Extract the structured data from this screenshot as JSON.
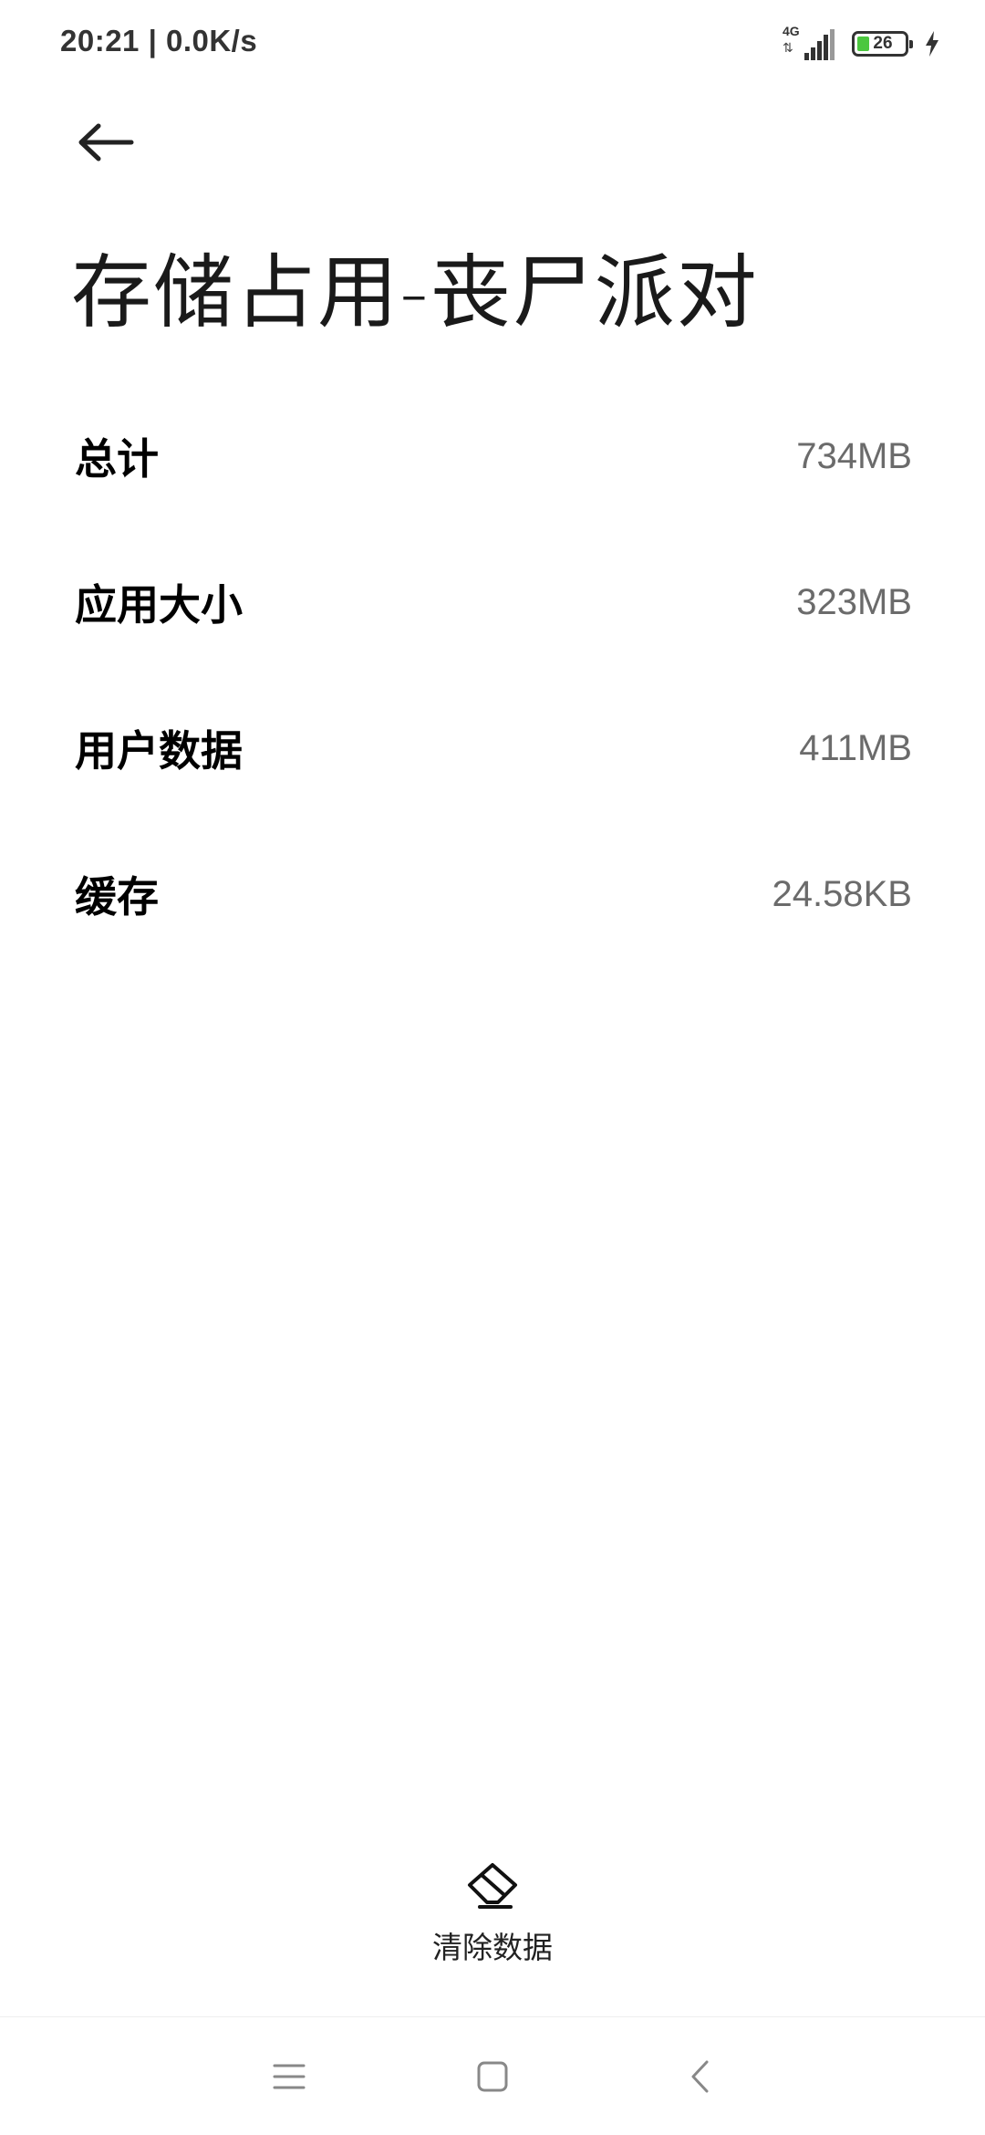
{
  "status_bar": {
    "time_speed": "20:21 | 0.0K/s",
    "network_type": "4G",
    "battery_level": "26",
    "battery_fraction": 0.26
  },
  "header": {
    "back_icon": "arrow-left-icon",
    "title": "存储占用-丧尸派对"
  },
  "storage_rows": [
    {
      "label": "总计",
      "value": "734MB"
    },
    {
      "label": "应用大小",
      "value": "323MB"
    },
    {
      "label": "用户数据",
      "value": "411MB"
    },
    {
      "label": "缓存",
      "value": "24.58KB"
    }
  ],
  "actions": {
    "clear_data_icon": "eraser-icon",
    "clear_data_label": "清除数据"
  },
  "nav_bar": {
    "menu_icon": "menu-icon",
    "home_icon": "home-square-icon",
    "back_icon": "chevron-left-icon"
  },
  "colors": {
    "background": "#ffffff",
    "value_text": "#6b6b6b",
    "battery_fill": "#4cc73f"
  }
}
